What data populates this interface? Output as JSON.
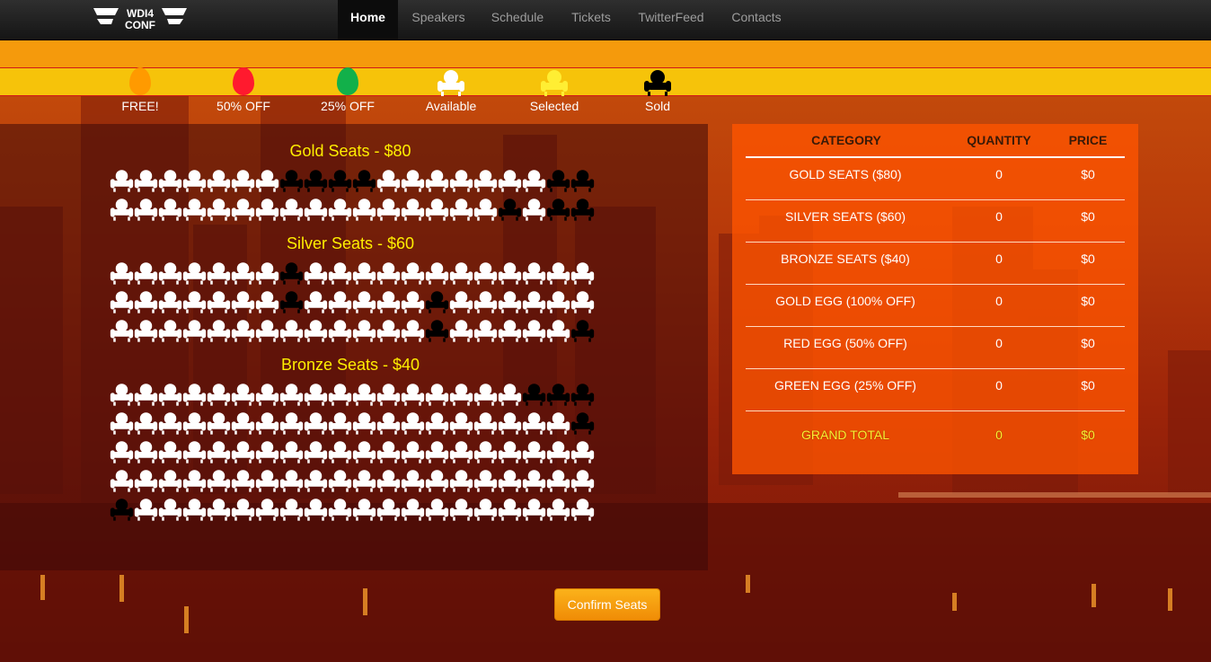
{
  "logo": {
    "line1": "WDI4",
    "line2": "CONF"
  },
  "nav": {
    "items": [
      {
        "label": "Home",
        "active": true
      },
      {
        "label": "Speakers",
        "active": false
      },
      {
        "label": "Schedule",
        "active": false
      },
      {
        "label": "Tickets",
        "active": false
      },
      {
        "label": "TwitterFeed",
        "active": false
      },
      {
        "label": "Contacts",
        "active": false
      }
    ]
  },
  "legend": [
    {
      "icon": "orange-egg-icon",
      "label": "FREE!",
      "color": "#ff9a00"
    },
    {
      "icon": "red-egg-icon",
      "label": "50% OFF",
      "color": "#ff1a2e"
    },
    {
      "icon": "green-egg-icon",
      "label": "25% OFF",
      "color": "#12b04a"
    },
    {
      "icon": "available-seat-icon",
      "label": "Available",
      "color": "#ffffff"
    },
    {
      "icon": "selected-seat-icon",
      "label": "Selected",
      "color": "#ffee33"
    },
    {
      "icon": "sold-seat-icon",
      "label": "Sold",
      "color": "#000000"
    }
  ],
  "seat_map": {
    "sections": [
      {
        "title": "Gold Seats - $80",
        "rows": [
          [
            "A",
            "A",
            "A",
            "A",
            "A",
            "A",
            "A",
            "S",
            "S",
            "S",
            "S",
            "A",
            "A",
            "A",
            "A",
            "A",
            "A",
            "A",
            "S",
            "S"
          ],
          [
            "A",
            "A",
            "A",
            "A",
            "A",
            "A",
            "A",
            "A",
            "A",
            "A",
            "A",
            "A",
            "A",
            "A",
            "A",
            "A",
            "S",
            "A",
            "S",
            "S"
          ]
        ]
      },
      {
        "title": "Silver Seats - $60",
        "rows": [
          [
            "A",
            "A",
            "A",
            "A",
            "A",
            "A",
            "A",
            "S",
            "A",
            "A",
            "A",
            "A",
            "A",
            "A",
            "A",
            "A",
            "A",
            "A",
            "A",
            "A"
          ],
          [
            "A",
            "A",
            "A",
            "A",
            "A",
            "A",
            "A",
            "S",
            "A",
            "A",
            "A",
            "A",
            "A",
            "S",
            "A",
            "A",
            "A",
            "A",
            "A",
            "A"
          ],
          [
            "A",
            "A",
            "A",
            "A",
            "A",
            "A",
            "A",
            "A",
            "A",
            "A",
            "A",
            "A",
            "A",
            "S",
            "A",
            "A",
            "A",
            "A",
            "A",
            "S"
          ]
        ]
      },
      {
        "title": "Bronze Seats - $40",
        "rows": [
          [
            "A",
            "A",
            "A",
            "A",
            "A",
            "A",
            "A",
            "A",
            "A",
            "A",
            "A",
            "A",
            "A",
            "A",
            "A",
            "A",
            "A",
            "S",
            "S",
            "S"
          ],
          [
            "A",
            "A",
            "A",
            "A",
            "A",
            "A",
            "A",
            "A",
            "A",
            "A",
            "A",
            "A",
            "A",
            "A",
            "A",
            "A",
            "A",
            "A",
            "A",
            "S"
          ],
          [
            "A",
            "A",
            "A",
            "A",
            "A",
            "A",
            "A",
            "A",
            "A",
            "A",
            "A",
            "A",
            "A",
            "A",
            "A",
            "A",
            "A",
            "A",
            "A",
            "A"
          ],
          [
            "A",
            "A",
            "A",
            "A",
            "A",
            "A",
            "A",
            "A",
            "A",
            "A",
            "A",
            "A",
            "A",
            "A",
            "A",
            "A",
            "A",
            "A",
            "A",
            "A"
          ],
          [
            "S",
            "A",
            "A",
            "A",
            "A",
            "A",
            "A",
            "A",
            "A",
            "A",
            "A",
            "A",
            "A",
            "A",
            "A",
            "A",
            "A",
            "A",
            "A",
            "A"
          ]
        ]
      }
    ]
  },
  "summary": {
    "headers": {
      "category": "CATEGORY",
      "quantity": "QUANTITY",
      "price": "PRICE"
    },
    "rows": [
      {
        "category": "GOLD SEATS ($80)",
        "quantity": "0",
        "price": "$0"
      },
      {
        "category": "SILVER SEATS ($60)",
        "quantity": "0",
        "price": "$0"
      },
      {
        "category": "BRONZE SEATS ($40)",
        "quantity": "0",
        "price": "$0"
      },
      {
        "category": "GOLD EGG (100% OFF)",
        "quantity": "0",
        "price": "$0"
      },
      {
        "category": "RED EGG (50% OFF)",
        "quantity": "0",
        "price": "$0"
      },
      {
        "category": "GREEN EGG (25% OFF)",
        "quantity": "0",
        "price": "$0"
      }
    ],
    "total": {
      "label": "GRAND TOTAL",
      "quantity": "0",
      "price": "$0"
    }
  },
  "confirm_button": "Confirm Seats",
  "colors": {
    "accent": "#f59a0c",
    "highlight": "#ffee00",
    "nav_bg": "#1f1f1f"
  }
}
